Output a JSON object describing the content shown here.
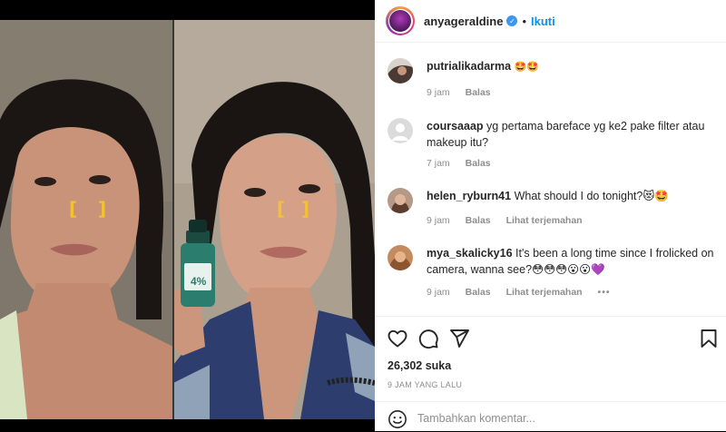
{
  "post": {
    "username": "anyageraldine",
    "separator": "•",
    "follow_label": "Ikuti",
    "verified_glyph": "✓"
  },
  "comments": [
    {
      "user": "putrialikadarma",
      "text": "🤩🤩",
      "time": "9 jam",
      "reply": "Balas"
    },
    {
      "user": "coursaaap",
      "text": "yg pertama bareface yg ke2 pake filter atau makeup itu?",
      "time": "7 jam",
      "reply": "Balas"
    },
    {
      "user": "helen_ryburn41",
      "text": "What should I do tonight?😻🤩",
      "time": "9 jam",
      "reply": "Balas",
      "translate": "Lihat terjemahan"
    },
    {
      "user": "mya_skalicky16",
      "text": "It's been a long time since I frolicked on camera, wanna see?😳😳😳😮😮💜",
      "time": "9 jam",
      "reply": "Balas",
      "translate": "Lihat terjemahan",
      "more": "•••"
    }
  ],
  "stats": {
    "likes": "26,302 suka",
    "time_ago": "9 JAM YANG LALU"
  },
  "add_comment": {
    "placeholder": "Tambahkan komentar..."
  },
  "media": {
    "bracket_open": "[",
    "bracket_close": "]"
  },
  "icons": {
    "like": "heart-icon",
    "comment": "comment-icon",
    "share": "paper-plane-icon",
    "save": "bookmark-icon",
    "emoji": "smile-icon"
  },
  "colors": {
    "accent": "#0095f6",
    "verified": "#3897f0",
    "bracket": "#f2c230",
    "meta": "#8e8e8e"
  }
}
